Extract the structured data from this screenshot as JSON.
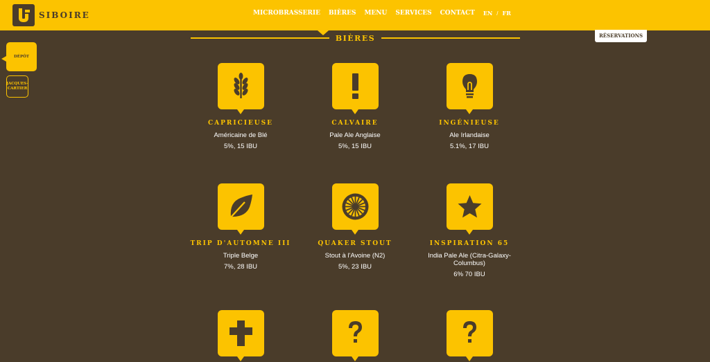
{
  "brand": {
    "name": "SIBOIRE"
  },
  "nav": {
    "items": [
      "MICROBRASSERIE",
      "BIÈRES",
      "MENU",
      "SERVICES",
      "CONTACT"
    ],
    "lang_en": "EN",
    "lang_sep": "/",
    "lang_fr": "FR"
  },
  "section": {
    "title": "BIÈRES"
  },
  "reservations_label": "RÉSERVATIONS",
  "locations": {
    "active": "DÉPÔT",
    "inactive_line1": "JACQUES-",
    "inactive_line2": "CARTIER"
  },
  "beers": [
    {
      "name": "CAPRICIEUSE",
      "style": "Américaine de Blé",
      "abv": "5%, 15 IBU",
      "icon": "wheat-icon"
    },
    {
      "name": "CALVAIRE",
      "style": "Pale Ale Anglaise",
      "abv": "5%, 15 IBU",
      "icon": "exclamation-icon"
    },
    {
      "name": "INGÉNIEUSE",
      "style": "Ale Irlandaise",
      "abv": "5.1%, 17 IBU",
      "icon": "lightbulb-icon"
    },
    {
      "name": "TRIP D'AUTOMNE III",
      "style": "Triple Belge",
      "abv": "7%, 28 IBU",
      "icon": "leaf-icon"
    },
    {
      "name": "QUAKER STOUT",
      "style": "Stout à l'Avoine (N2)",
      "abv": "5%, 23 IBU",
      "icon": "wheel-icon"
    },
    {
      "name": "INSPIRATION 65",
      "style": "India Pale Ale (Citra-Galaxy-Columbus)",
      "abv": "6% 70 IBU",
      "icon": "star-icon"
    },
    {
      "icon": "cross-icon"
    },
    {
      "icon": "question-icon"
    },
    {
      "icon": "question-icon"
    }
  ],
  "colors": {
    "brand_yellow": "#fcc300",
    "background_brown": "#4a3c2a",
    "text_white": "#ffffff"
  }
}
